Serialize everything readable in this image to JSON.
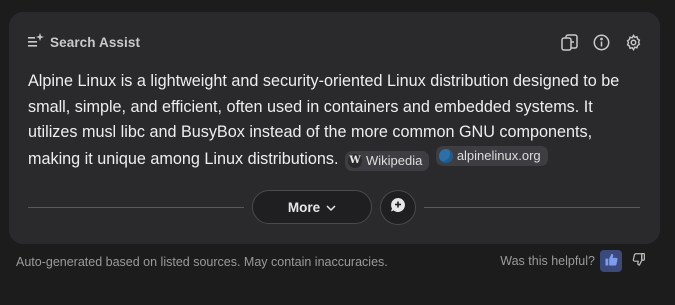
{
  "header": {
    "title": "Search Assist",
    "icons": [
      "sparkle-list-icon",
      "copy-icon",
      "info-icon",
      "settings-icon"
    ]
  },
  "summary": {
    "text": "Alpine Linux is a lightweight and security-oriented Linux distribution designed to be small, simple, and efficient, often used in containers and embedded systems. It utilizes musl libc and BusyBox instead of the more common GNU components, making it unique among Linux distributions.",
    "sources": [
      {
        "label": "Wikipedia",
        "icon": "wikipedia-icon"
      },
      {
        "label": "alpinelinux.org",
        "icon": "globe-icon"
      }
    ]
  },
  "actions": {
    "more_label": "More",
    "chat_icon": "chat-icon"
  },
  "footer": {
    "disclaimer": "Auto-generated based on listed sources. May contain inaccuracies.",
    "helpful_label": "Was this helpful?"
  },
  "colors": {
    "background": "#1c1c1c",
    "card": "#2a2a2d",
    "chip": "#3d3d42",
    "thumb_up_active": "#3b4a7a",
    "thumb_up_icon": "#7d9cf0"
  }
}
